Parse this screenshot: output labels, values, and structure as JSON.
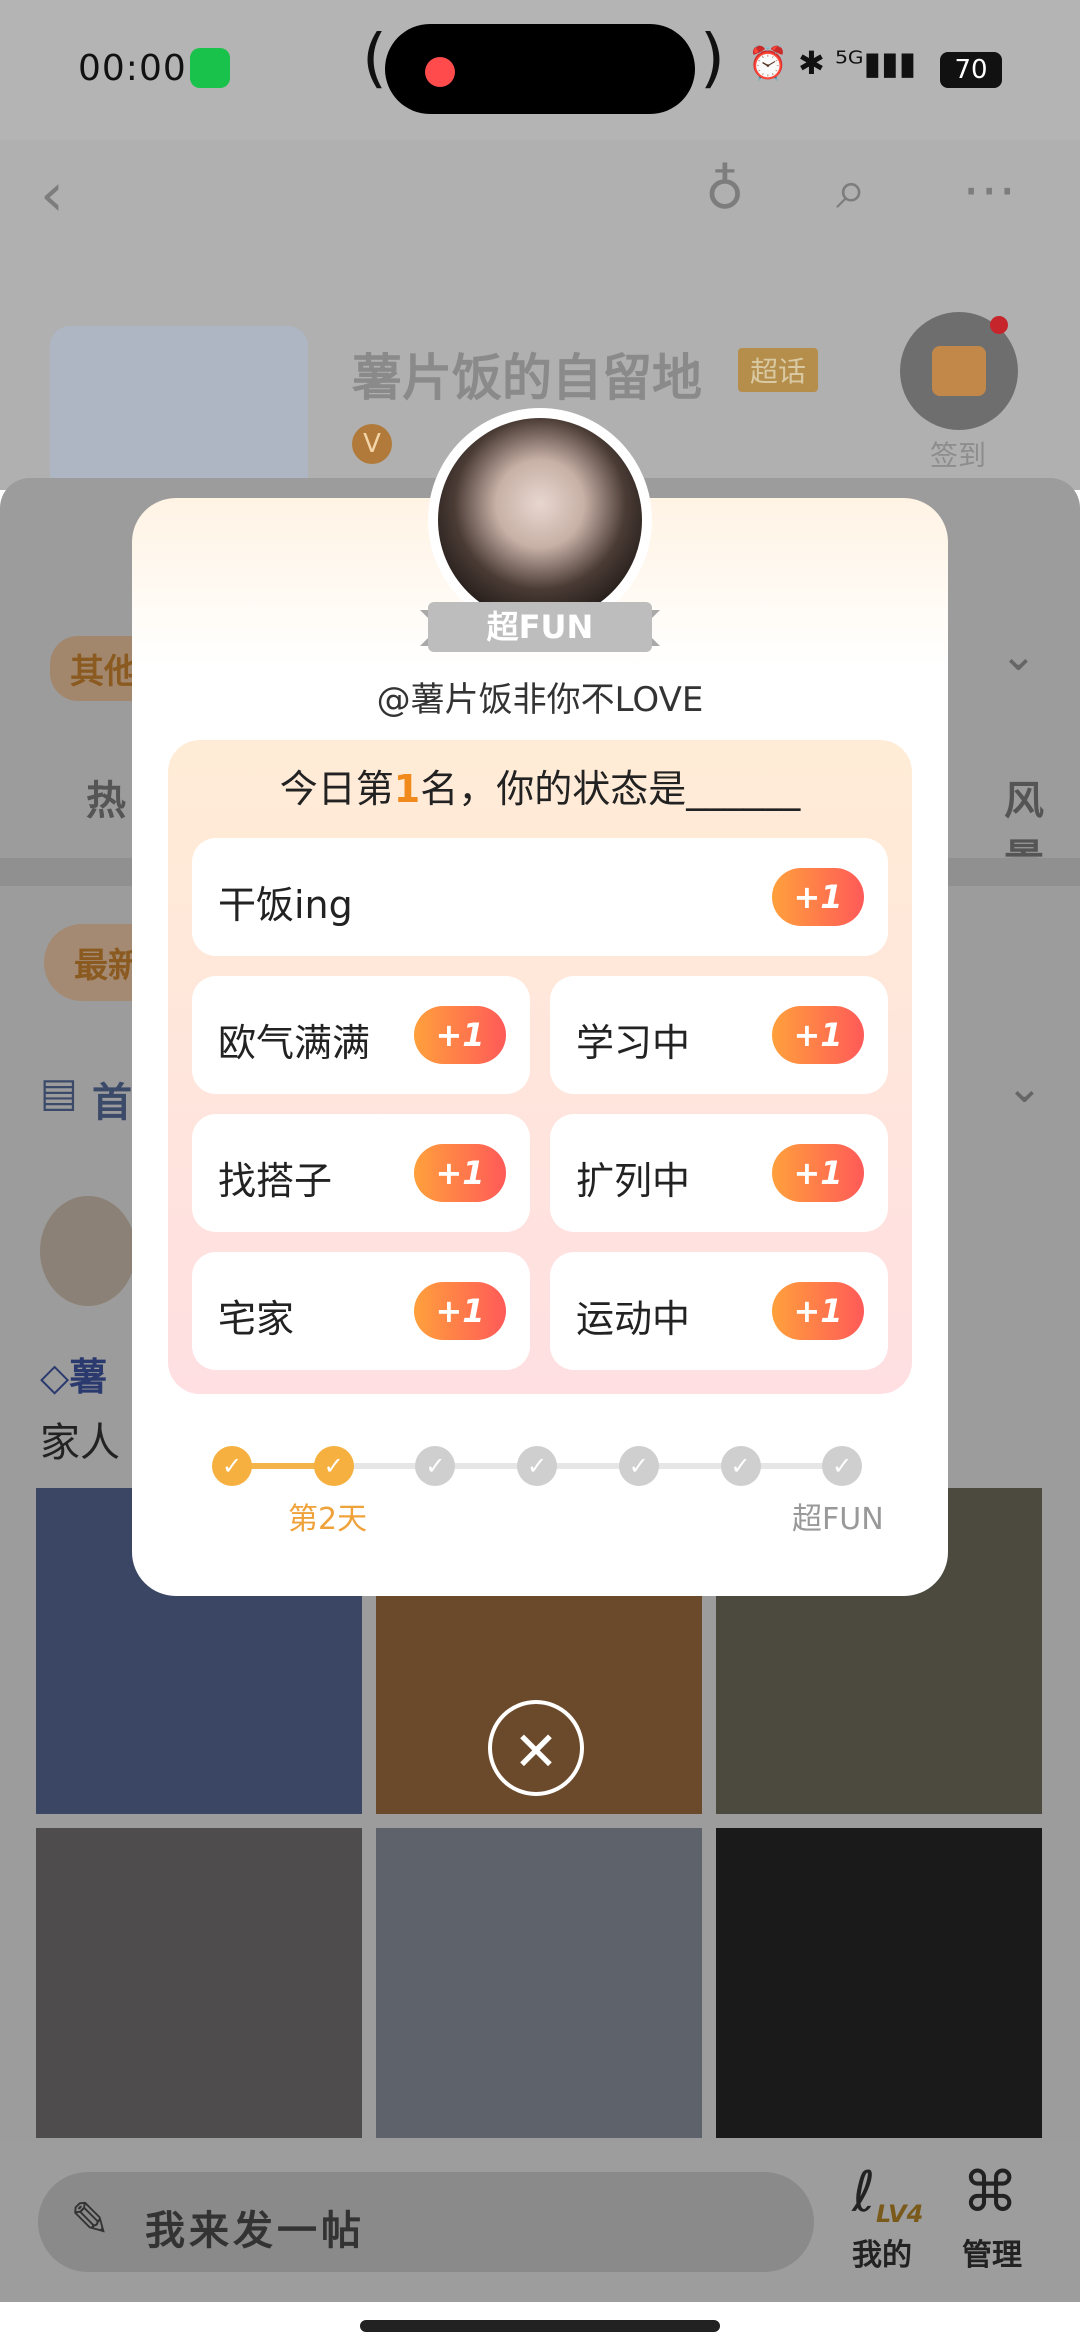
{
  "status_bar": {
    "time": "00:00",
    "battery": "70",
    "icons": "⏰ ✱ ⁵ᴳ▮▮▮"
  },
  "header": {
    "title": "薯片饭的自留地",
    "badge": "超话",
    "v_badge": "V",
    "sign_label": "签到"
  },
  "background": {
    "tag_left": "其他",
    "tab_left": "热",
    "tab_right": "风景",
    "filter": "最新",
    "homepage": "首",
    "poster_name": "薯",
    "poster_text": "家人"
  },
  "popup": {
    "badge": "超FUN",
    "handle": "@薯片饭非你不LOVE",
    "question_prefix": "今日第",
    "rank": "1",
    "question_suffix": "名，你的状态是______",
    "options": [
      {
        "label": "干饭ing",
        "action": "+1"
      },
      {
        "label": "欧气满满",
        "action": "+1"
      },
      {
        "label": "学习中",
        "action": "+1"
      },
      {
        "label": "找搭子",
        "action": "+1"
      },
      {
        "label": "扩列中",
        "action": "+1"
      },
      {
        "label": "宅家",
        "action": "+1"
      },
      {
        "label": "运动中",
        "action": "+1"
      }
    ],
    "progress_days_done": 2,
    "progress_days_total": 7,
    "progress_current_label": "第2天",
    "progress_end_label": "超FUN",
    "check": "✓",
    "close": "✕"
  },
  "bottom": {
    "compose_placeholder": "我来发一帖",
    "nav_mine": "我的",
    "nav_manage": "管理",
    "level": "LV4"
  },
  "colors": {
    "accent": "#f08a1c",
    "plus_from": "#ffa03c",
    "plus_to": "#ff5a58",
    "progress_done": "#f5b040"
  }
}
